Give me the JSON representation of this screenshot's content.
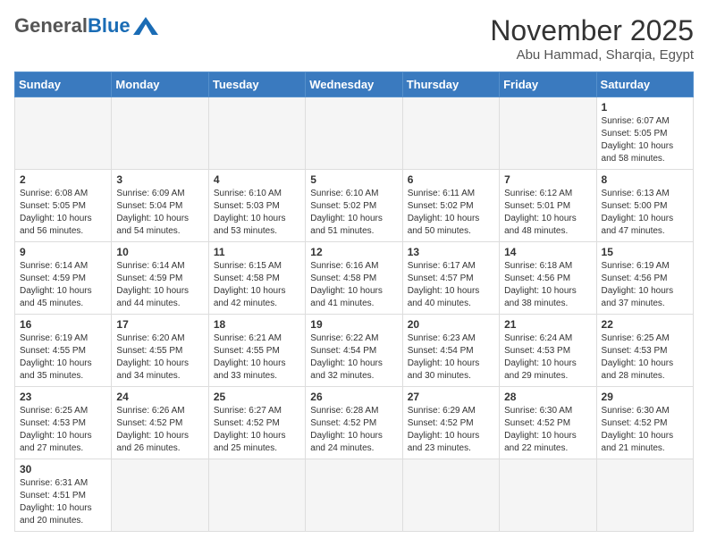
{
  "header": {
    "logo_general": "General",
    "logo_blue": "Blue",
    "month": "November 2025",
    "location": "Abu Hammad, Sharqia, Egypt"
  },
  "days": [
    "Sunday",
    "Monday",
    "Tuesday",
    "Wednesday",
    "Thursday",
    "Friday",
    "Saturday"
  ],
  "weeks": [
    [
      {
        "date": "",
        "info": ""
      },
      {
        "date": "",
        "info": ""
      },
      {
        "date": "",
        "info": ""
      },
      {
        "date": "",
        "info": ""
      },
      {
        "date": "",
        "info": ""
      },
      {
        "date": "",
        "info": ""
      },
      {
        "date": "1",
        "info": "Sunrise: 6:07 AM\nSunset: 5:05 PM\nDaylight: 10 hours\nand 58 minutes."
      }
    ],
    [
      {
        "date": "2",
        "info": "Sunrise: 6:08 AM\nSunset: 5:05 PM\nDaylight: 10 hours\nand 56 minutes."
      },
      {
        "date": "3",
        "info": "Sunrise: 6:09 AM\nSunset: 5:04 PM\nDaylight: 10 hours\nand 54 minutes."
      },
      {
        "date": "4",
        "info": "Sunrise: 6:10 AM\nSunset: 5:03 PM\nDaylight: 10 hours\nand 53 minutes."
      },
      {
        "date": "5",
        "info": "Sunrise: 6:10 AM\nSunset: 5:02 PM\nDaylight: 10 hours\nand 51 minutes."
      },
      {
        "date": "6",
        "info": "Sunrise: 6:11 AM\nSunset: 5:02 PM\nDaylight: 10 hours\nand 50 minutes."
      },
      {
        "date": "7",
        "info": "Sunrise: 6:12 AM\nSunset: 5:01 PM\nDaylight: 10 hours\nand 48 minutes."
      },
      {
        "date": "8",
        "info": "Sunrise: 6:13 AM\nSunset: 5:00 PM\nDaylight: 10 hours\nand 47 minutes."
      }
    ],
    [
      {
        "date": "9",
        "info": "Sunrise: 6:14 AM\nSunset: 4:59 PM\nDaylight: 10 hours\nand 45 minutes."
      },
      {
        "date": "10",
        "info": "Sunrise: 6:14 AM\nSunset: 4:59 PM\nDaylight: 10 hours\nand 44 minutes."
      },
      {
        "date": "11",
        "info": "Sunrise: 6:15 AM\nSunset: 4:58 PM\nDaylight: 10 hours\nand 42 minutes."
      },
      {
        "date": "12",
        "info": "Sunrise: 6:16 AM\nSunset: 4:58 PM\nDaylight: 10 hours\nand 41 minutes."
      },
      {
        "date": "13",
        "info": "Sunrise: 6:17 AM\nSunset: 4:57 PM\nDaylight: 10 hours\nand 40 minutes."
      },
      {
        "date": "14",
        "info": "Sunrise: 6:18 AM\nSunset: 4:56 PM\nDaylight: 10 hours\nand 38 minutes."
      },
      {
        "date": "15",
        "info": "Sunrise: 6:19 AM\nSunset: 4:56 PM\nDaylight: 10 hours\nand 37 minutes."
      }
    ],
    [
      {
        "date": "16",
        "info": "Sunrise: 6:19 AM\nSunset: 4:55 PM\nDaylight: 10 hours\nand 35 minutes."
      },
      {
        "date": "17",
        "info": "Sunrise: 6:20 AM\nSunset: 4:55 PM\nDaylight: 10 hours\nand 34 minutes."
      },
      {
        "date": "18",
        "info": "Sunrise: 6:21 AM\nSunset: 4:55 PM\nDaylight: 10 hours\nand 33 minutes."
      },
      {
        "date": "19",
        "info": "Sunrise: 6:22 AM\nSunset: 4:54 PM\nDaylight: 10 hours\nand 32 minutes."
      },
      {
        "date": "20",
        "info": "Sunrise: 6:23 AM\nSunset: 4:54 PM\nDaylight: 10 hours\nand 30 minutes."
      },
      {
        "date": "21",
        "info": "Sunrise: 6:24 AM\nSunset: 4:53 PM\nDaylight: 10 hours\nand 29 minutes."
      },
      {
        "date": "22",
        "info": "Sunrise: 6:25 AM\nSunset: 4:53 PM\nDaylight: 10 hours\nand 28 minutes."
      }
    ],
    [
      {
        "date": "23",
        "info": "Sunrise: 6:25 AM\nSunset: 4:53 PM\nDaylight: 10 hours\nand 27 minutes."
      },
      {
        "date": "24",
        "info": "Sunrise: 6:26 AM\nSunset: 4:52 PM\nDaylight: 10 hours\nand 26 minutes."
      },
      {
        "date": "25",
        "info": "Sunrise: 6:27 AM\nSunset: 4:52 PM\nDaylight: 10 hours\nand 25 minutes."
      },
      {
        "date": "26",
        "info": "Sunrise: 6:28 AM\nSunset: 4:52 PM\nDaylight: 10 hours\nand 24 minutes."
      },
      {
        "date": "27",
        "info": "Sunrise: 6:29 AM\nSunset: 4:52 PM\nDaylight: 10 hours\nand 23 minutes."
      },
      {
        "date": "28",
        "info": "Sunrise: 6:30 AM\nSunset: 4:52 PM\nDaylight: 10 hours\nand 22 minutes."
      },
      {
        "date": "29",
        "info": "Sunrise: 6:30 AM\nSunset: 4:52 PM\nDaylight: 10 hours\nand 21 minutes."
      }
    ],
    [
      {
        "date": "30",
        "info": "Sunrise: 6:31 AM\nSunset: 4:51 PM\nDaylight: 10 hours\nand 20 minutes."
      },
      {
        "date": "",
        "info": ""
      },
      {
        "date": "",
        "info": ""
      },
      {
        "date": "",
        "info": ""
      },
      {
        "date": "",
        "info": ""
      },
      {
        "date": "",
        "info": ""
      },
      {
        "date": "",
        "info": ""
      }
    ]
  ]
}
